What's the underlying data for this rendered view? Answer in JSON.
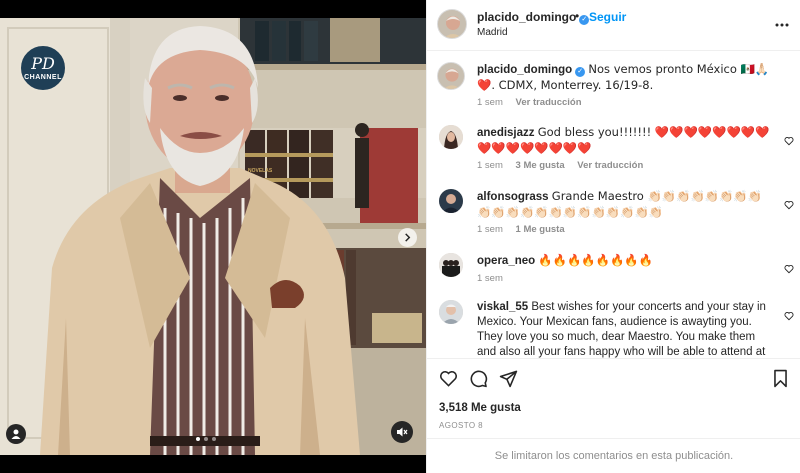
{
  "post": {
    "username": "placido_domingo",
    "verified": true,
    "separator": "•",
    "follow_label": "Seguir",
    "location": "Madrid",
    "more_label": "...",
    "likes": "3,518 Me gusta",
    "date": "AGOSTO 8",
    "comments_limited": "Se limitaron los comentarios en esta publicación."
  },
  "media": {
    "channel_logo_monogram": "PD",
    "channel_logo_word": "CHANNEL",
    "book_spine_text": "NOVELAS",
    "slide_count": 3,
    "active_slide": 1
  },
  "caption": {
    "username": "placido_domingo",
    "text": "Nos vemos pronto México 🇲🇽🙏🏻❤️. CDMX, Monterrey. 16/19-8.",
    "time": "1 sem",
    "translate": "Ver traducción"
  },
  "comments": [
    {
      "username": "anedisjazz",
      "text": "God bless you!!!!!!! ❤️❤️❤️❤️❤️❤️❤️❤️❤️❤️❤️❤️❤️❤️❤️❤️",
      "time": "1 sem",
      "likes": "3 Me gusta",
      "translate": "Ver traducción"
    },
    {
      "username": "alfonsograss",
      "text": "Grande Maestro 👏🏻👏🏻👏🏻👏🏻👏🏻👏🏻👏🏻👏🏻👏🏻👏🏻👏🏻👏🏻👏🏻👏🏻👏🏻👏🏻👏🏻👏🏻👏🏻👏🏻👏🏻",
      "time": "1 sem",
      "likes": "1 Me gusta"
    },
    {
      "username": "opera_neo",
      "text": "🔥🔥🔥🔥🔥🔥🔥🔥",
      "time": "1 sem"
    },
    {
      "username": "viskal_55",
      "text": "Best wishes for your concerts and your stay in Mexico. Your Mexican fans, audience is awayting you. They love you so much, dear Maestro. You make them and also all your fans happy who will be able to attend at least one of"
    }
  ],
  "colors": {
    "accent": "#0095f6",
    "text": "#262626",
    "muted": "#8e8e8e",
    "heart": "#ed4956",
    "verified": "#3897f0"
  },
  "icons": {
    "like": "heart-outline-icon",
    "comment": "comment-bubble-icon",
    "share": "paper-plane-icon",
    "save": "bookmark-icon",
    "more": "more-horizontal-icon",
    "tag": "user-tag-icon",
    "mute": "muted-speaker-icon",
    "next": "chevron-right-icon"
  }
}
